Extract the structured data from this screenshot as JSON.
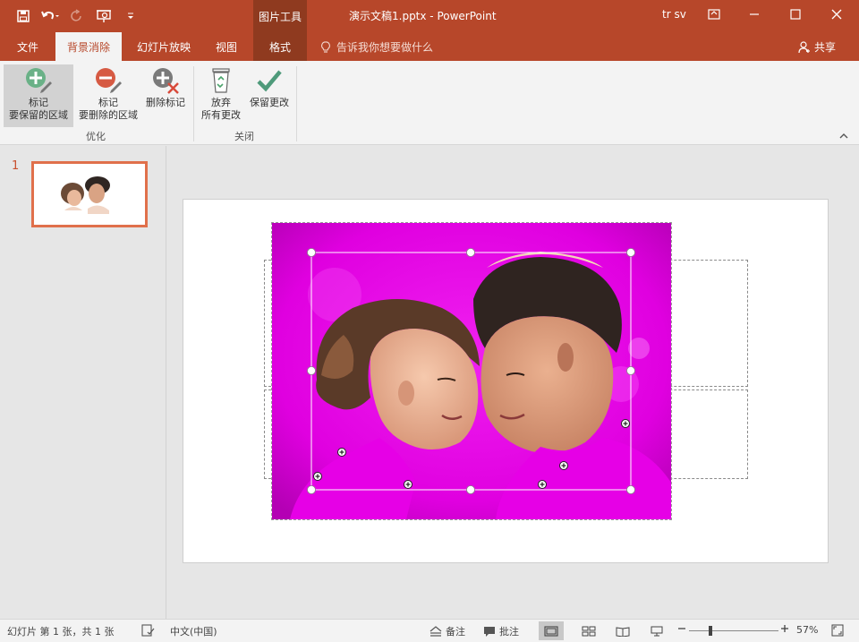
{
  "titlebar": {
    "context_header": "图片工具",
    "document_title": "演示文稿1.pptx  -  PowerPoint",
    "user": "tr sv"
  },
  "tabs": {
    "file": "文件",
    "background_removal": "背景消除",
    "slideshow": "幻灯片放映",
    "view": "视图",
    "format": "格式"
  },
  "tellme": {
    "label": "告诉我你想要做什么"
  },
  "share": {
    "label": "共享"
  },
  "ribbon": {
    "mark_keep_line1": "标记",
    "mark_keep_line2": "要保留的区域",
    "mark_remove_line1": "标记",
    "mark_remove_line2": "要删除的区域",
    "delete_mark": "删除标记",
    "discard_line1": "放弃",
    "discard_line2": "所有更改",
    "keep_changes": "保留更改",
    "group_refine": "优化",
    "group_close": "关闭"
  },
  "thumbnails": {
    "slide_number": "1"
  },
  "statusbar": {
    "slide_info": "幻灯片 第 1 张，共 1 张",
    "language": "中文(中国)",
    "notes": "备注",
    "comments": "批注",
    "zoom": "57%"
  },
  "colors": {
    "accent": "#b7472a",
    "accent_dark": "#8f3a1f",
    "removal_overlay": "#e600e6",
    "thumbnail_border": "#e0704b"
  }
}
